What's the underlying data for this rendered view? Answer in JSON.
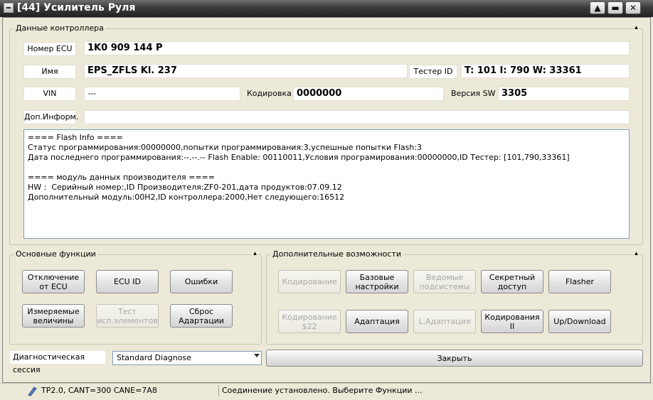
{
  "window": {
    "title": "[44] Усилитель Руля"
  },
  "titlebar_buttons": {
    "restore": "▲",
    "minimize": "▬",
    "close": "✕"
  },
  "controller": {
    "group_title": "Данные контроллера",
    "ecu_number_label": "Номер ECU",
    "ecu_number_value": "1K0 909 144 P",
    "name_label": "Имя",
    "name_value": "EPS_ZFLS Kl. 237",
    "tester_id_label": "Тестер ID",
    "tester_id_value": "T: 101 I: 790 W: 33361",
    "vin_label": "VIN",
    "vin_value": "---",
    "coding_label": "Кодировка",
    "coding_value": "0000000",
    "sw_version_label": "Версия SW",
    "sw_version_value": "3305",
    "extra_info_label": "Доп.Информ.",
    "extra_info_value": "",
    "info_lines": [
      "==== Flash Info ====",
      "Статус программирования:00000000,попытки программирования:3,успешные попытки Flash:3",
      "Дата последнего программирования:--.--.-- Flash Enable: 00110011,Условия програмирования:00000000,ID Тестер: [101,790,33361]",
      "",
      "==== модуль данных производителя ====",
      "HW :  Серийный номер:,ID Производителя:ZF0-201,дата продуктов:07.09.12",
      "Дополнительный модуль:00H2,ID контроллера:2000,Нет следующего:16512"
    ]
  },
  "basic_functions": {
    "group_title": "Основные функции",
    "buttons": [
      {
        "label": "Отключение от ECU",
        "enabled": true
      },
      {
        "label": "ECU ID",
        "enabled": true
      },
      {
        "label": "Ошибки",
        "enabled": true
      },
      {
        "label": "Измеряемые величины",
        "enabled": true
      },
      {
        "label": "Тест исп.элементов",
        "enabled": false
      },
      {
        "label": "Сброс Адартации",
        "enabled": true
      }
    ]
  },
  "extra_functions": {
    "group_title": "Дополнительные возможности",
    "buttons": [
      {
        "label": "Кодирование",
        "enabled": false
      },
      {
        "label": "Базовые настройки",
        "enabled": true
      },
      {
        "label": "Ведомые подсистемы",
        "enabled": false
      },
      {
        "label": "Секретный доступ",
        "enabled": true
      },
      {
        "label": "Flasher",
        "enabled": true
      },
      {
        "label": "Кодирование $22",
        "enabled": false
      },
      {
        "label": "Адаптация",
        "enabled": true
      },
      {
        "label": "L.Адаптация",
        "enabled": false
      },
      {
        "label": "Кодирования II",
        "enabled": true
      },
      {
        "label": "Up/Download",
        "enabled": true
      }
    ]
  },
  "diag_session": {
    "label": "Диагностическая сессия",
    "selected": "Standard Diagnose"
  },
  "close_button": "Закрыть",
  "status": {
    "connection": "TP2.0, CANT=300 CANE=7A8",
    "message": "Соединение установлено. Выберите Функции ..."
  }
}
